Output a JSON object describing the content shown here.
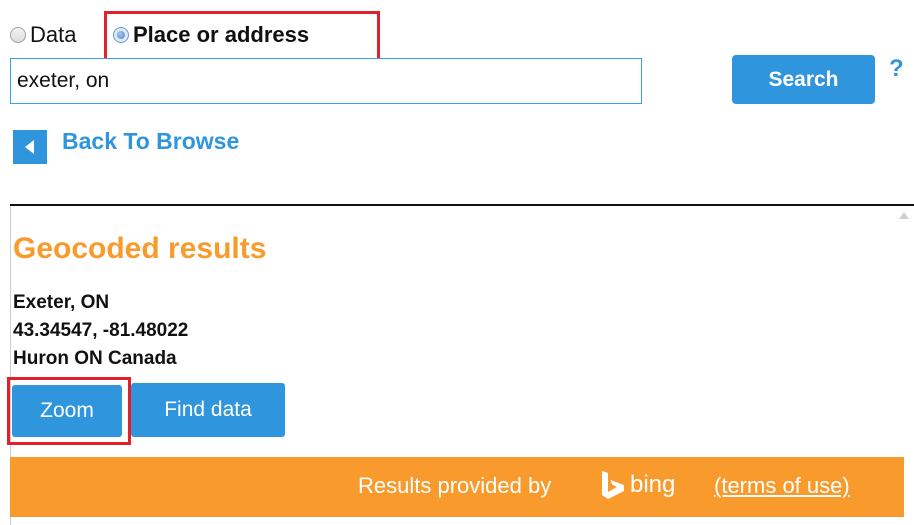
{
  "mode": {
    "options": [
      {
        "label": "Data",
        "selected": false
      },
      {
        "label": "Place or address",
        "selected": true
      }
    ]
  },
  "search": {
    "value": "exeter, on",
    "button_label": "Search",
    "help_label": "?"
  },
  "nav": {
    "back_label": "Back To Browse"
  },
  "results": {
    "title": "Geocoded results",
    "name": "Exeter, ON",
    "coords": "43.34547, -81.48022",
    "region": "Huron ON Canada",
    "zoom_label": "Zoom",
    "find_label": "Find data"
  },
  "footer": {
    "provided_by": "Results provided by",
    "bing": "bing",
    "terms": "(terms of use)"
  },
  "colors": {
    "accent_blue": "#2f95dc",
    "orange": "#f89b2c",
    "highlight_red": "#e32027"
  }
}
